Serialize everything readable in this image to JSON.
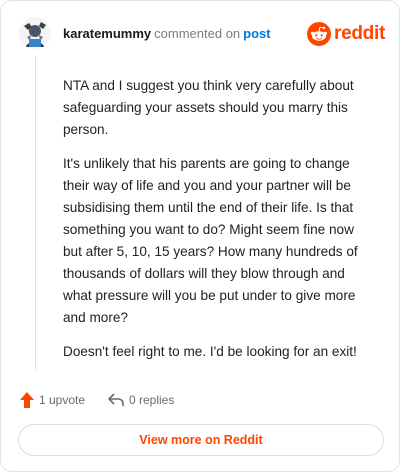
{
  "comment": {
    "username": "karatemummy",
    "verb": "commented on",
    "post_link": "post",
    "paragraphs": [
      "NTA and I suggest you think very carefully about safeguarding your assets should you marry this person.",
      "It's unlikely that his parents are going to change their way of life and you and your partner will be subsidising them until the end of their life. Is that something you want to do? Might seem fine now but after 5, 10, 15 years? How many hundreds of thousands of dollars will they blow through and what pressure will you be put under to give more and more?",
      "Doesn't feel right to me. I'd be looking for an exit!"
    ],
    "upvotes_label": "1 upvote",
    "replies_label": "0 replies"
  },
  "brand": {
    "wordmark": "reddit",
    "icon": "reddit-snoo-icon",
    "color": "#ff4500"
  },
  "footer": {
    "view_more_label": "View more on Reddit"
  },
  "colors": {
    "accent": "#ff4500",
    "link": "#0079d3",
    "text": "#1a1a1b",
    "muted": "#7c7c7c"
  }
}
